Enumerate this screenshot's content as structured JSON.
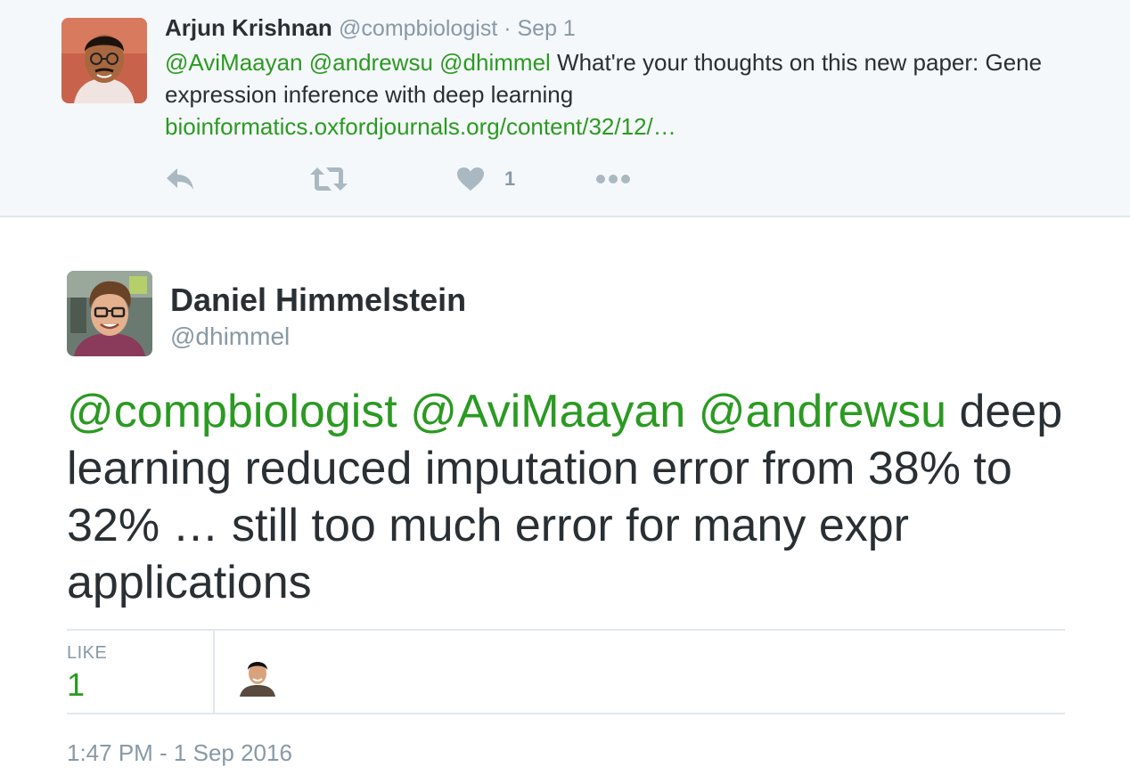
{
  "parent_tweet": {
    "author_name": "Arjun Krishnan",
    "handle": "@compbiologist",
    "separator": " · ",
    "date": "Sep 1",
    "mentions": [
      "@AviMaayan",
      "@andrewsu",
      "@dhimmel"
    ],
    "text": " What're your thoughts on this new paper: Gene expression inference with deep learning",
    "link": "bioinformatics.oxfordjournals.org/content/32/12/…",
    "like_count": "1"
  },
  "main_tweet": {
    "author_name": "Daniel Himmelstein",
    "handle": "@dhimmel",
    "mentions": [
      "@compbiologist",
      "@AviMaayan",
      "@andrewsu"
    ],
    "text": "deep learning reduced imputation error from 38% to 32% … still too much error for many expr applications",
    "likes_label": "LIKE",
    "likes_value": "1",
    "timestamp": "1:47 PM - 1 Sep 2016"
  },
  "colors": {
    "accent": "#2b9a22",
    "muted": "#8899a6",
    "text": "#292f33",
    "icon": "#aab8c2",
    "parent_bg": "#f5f8fa",
    "border": "#e1e8ed"
  },
  "icons": [
    "reply-icon",
    "retweet-icon",
    "heart-icon",
    "more-icon"
  ]
}
